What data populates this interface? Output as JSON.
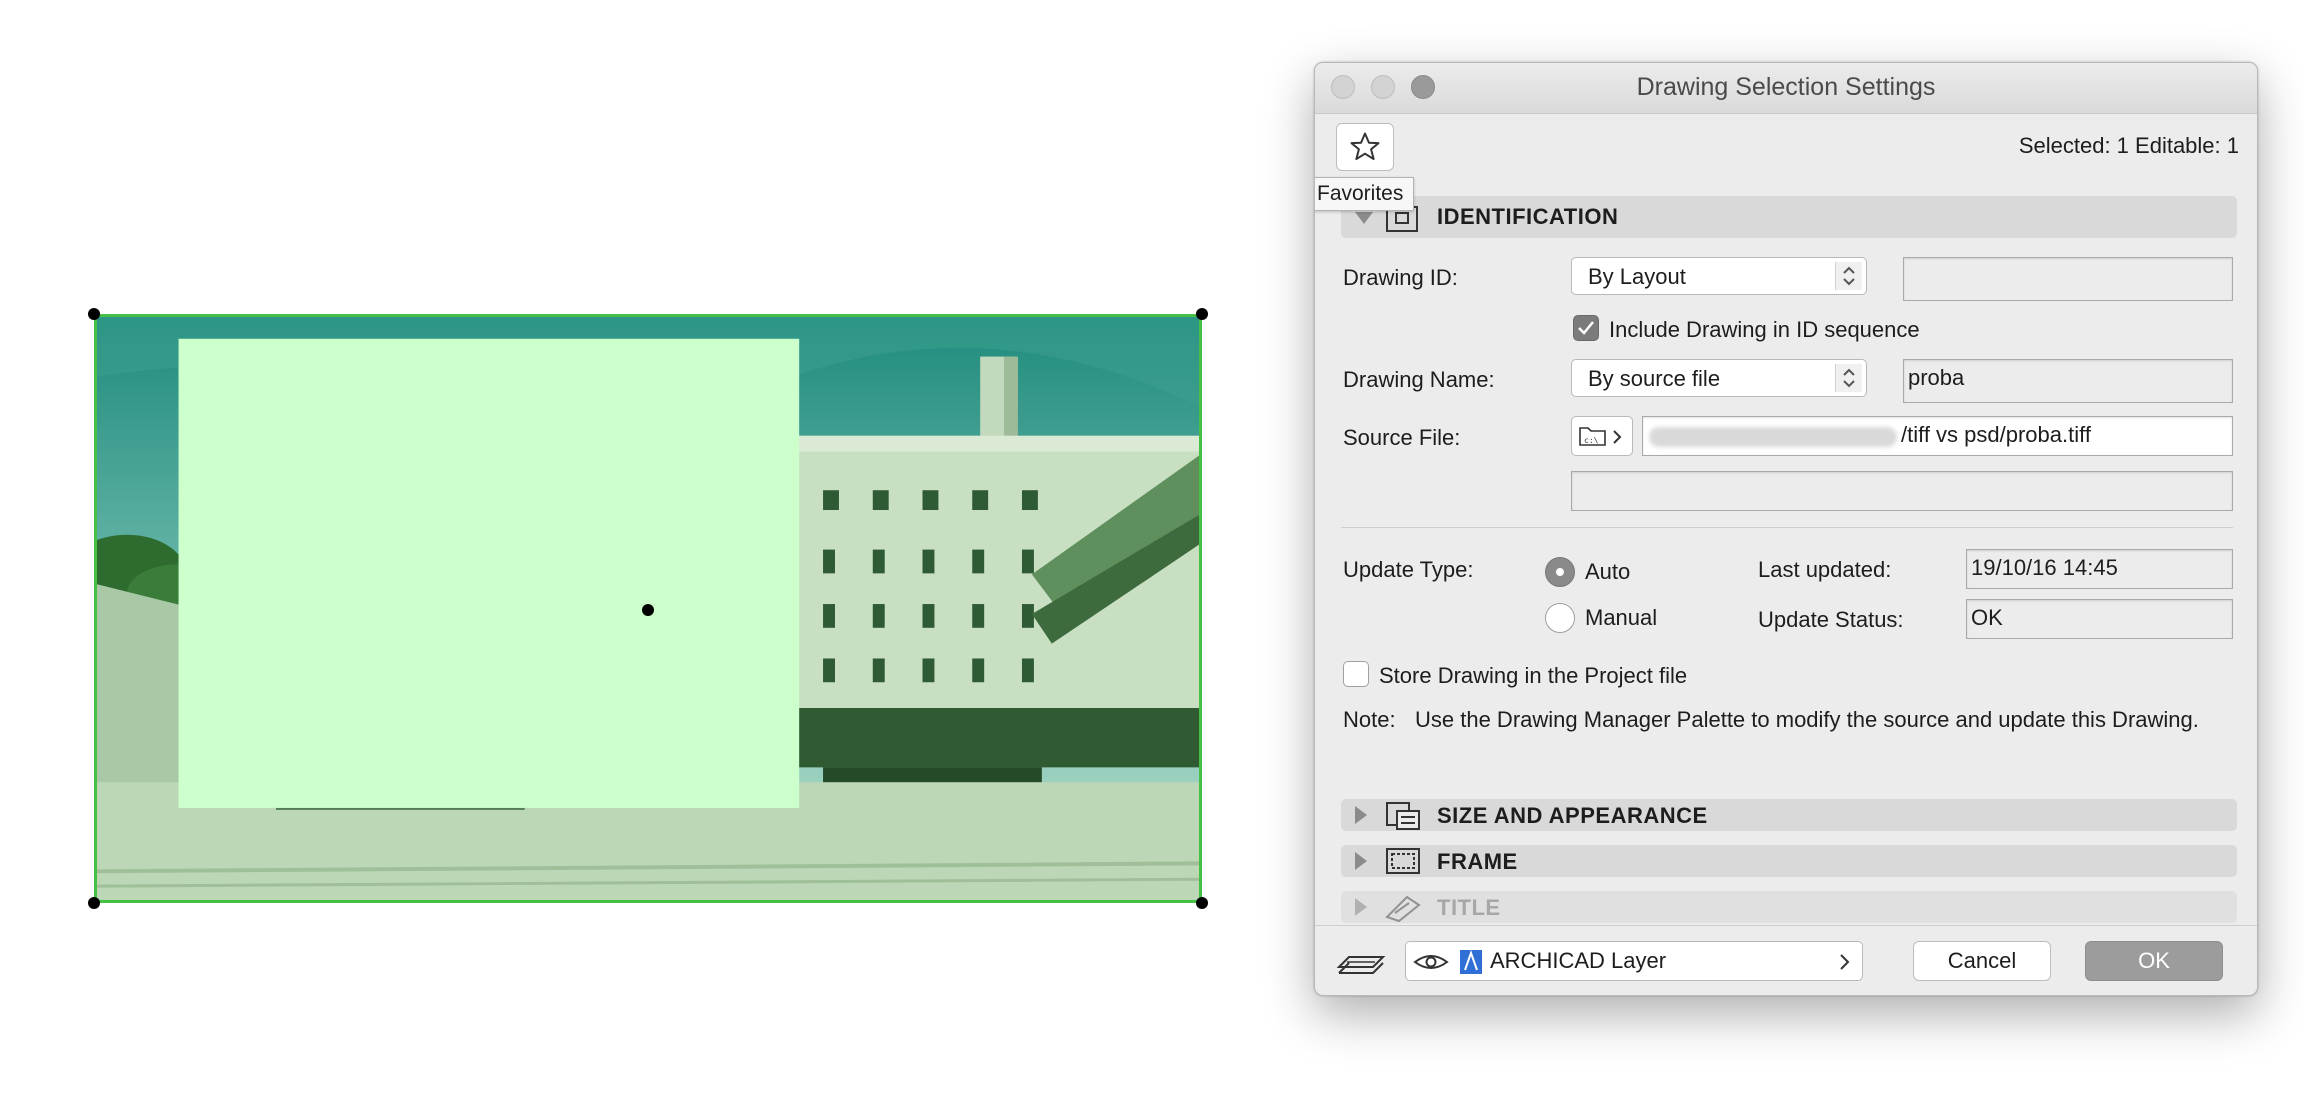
{
  "dialog": {
    "title": "Drawing Selection Settings",
    "selection_info": "Selected: 1 Editable: 1",
    "favorites_tooltip": "Favorites"
  },
  "identification": {
    "header": "IDENTIFICATION",
    "drawing_id_label": "Drawing ID:",
    "drawing_id_value": "By Layout",
    "drawing_id_field": "",
    "include_in_sequence_label": "Include Drawing in ID sequence",
    "include_in_sequence_checked": true,
    "drawing_name_label": "Drawing Name:",
    "drawing_name_mode": "By source file",
    "drawing_name_value": "proba",
    "source_file_label": "Source File:",
    "source_file_path": "/tiff vs psd/proba.tiff",
    "source_file_extra": "",
    "update_type_label": "Update Type:",
    "update_auto_label": "Auto",
    "update_manual_label": "Manual",
    "update_selected": "Auto",
    "last_updated_label": "Last updated:",
    "last_updated_value": "19/10/16 14:45",
    "update_status_label": "Update Status:",
    "update_status_value": "OK",
    "store_in_project_label": "Store Drawing in the Project file",
    "store_in_project_checked": false,
    "note_label": "Note:",
    "note_text": "Use the Drawing Manager Palette to modify the source and update this Drawing."
  },
  "sections": {
    "size_appearance": "SIZE AND APPEARANCE",
    "frame": "FRAME",
    "title": "TITLE"
  },
  "footer": {
    "layer_name": "ARCHICAD Layer",
    "cancel_label": "Cancel",
    "ok_label": "OK"
  },
  "colors": {
    "selection_green": "#44c144",
    "overlay_green": "#ccffcc",
    "ok_button": "#9c9c9c"
  }
}
